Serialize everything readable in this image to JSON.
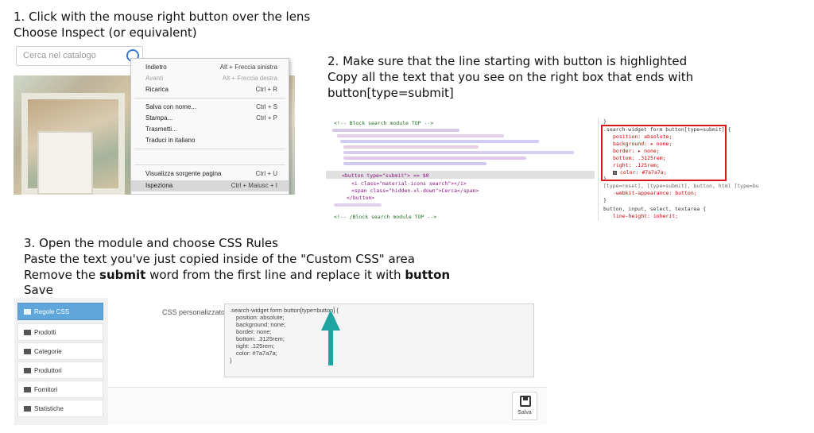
{
  "step1": {
    "line1": "1. Click with the mouse right button over the lens",
    "line2": "Choose Inspect (or equivalent)"
  },
  "step2": {
    "line1": "2. Make sure that the line starting with button is highlighted",
    "line2": "Copy all the text that you see on the right box that ends with",
    "line3": "button[type=submit]"
  },
  "step3": {
    "line1": "3. Open the module and choose CSS Rules",
    "line2": "Paste the text you've just copied inside of the \"Custom CSS\" area",
    "line3_pre": "Remove the ",
    "line3_b1": "submit",
    "line3_mid": " word from the first line and replace it with ",
    "line3_b2": "button",
    "line4": "Save"
  },
  "browser": {
    "search_placeholder": "Cerca nel catalogo",
    "context_menu": [
      {
        "label": "Indietro",
        "shortcut": "Alt + Freccia sinistra",
        "disabled": false
      },
      {
        "label": "Avanti",
        "shortcut": "Alt + Freccia destra",
        "disabled": true
      },
      {
        "label": "Ricarica",
        "shortcut": "Ctrl + R",
        "disabled": false
      },
      {
        "label": "Salva con nome...",
        "shortcut": "Ctrl + S",
        "disabled": false
      },
      {
        "label": "Stampa...",
        "shortcut": "Ctrl + P",
        "disabled": false
      },
      {
        "label": "Trasmetti...",
        "shortcut": "",
        "disabled": false
      },
      {
        "label": "Traduci in italiano",
        "shortcut": "",
        "disabled": false
      },
      {
        "label": "Visualizza sorgente pagina",
        "shortcut": "Ctrl + U",
        "disabled": false
      },
      {
        "label": "Ispeziona",
        "shortcut": "Ctrl + Maiusc + I",
        "disabled": false,
        "highlighted": true
      }
    ]
  },
  "devtools": {
    "comment_open": "<!-- Block search module TOP -->",
    "button_open": "<button type=\"submit\"> == $0",
    "icon_line": "<i class=\"material-icons search\"></i>",
    "span_line": "<span class=\"hidden-xl-down\">Cerca</span>",
    "button_close": "</button>",
    "comment_close": "<!-- /Block search module TOP -->",
    "rule_selector": ".search-widget form button[type=submit] {",
    "rule_props": [
      "position: absolute;",
      "background: ▸ none;",
      "border: ▸ none;",
      "bottom: .3125rem;",
      "right: .125rem;",
      "color: #7a7a7a;"
    ],
    "rule_close": "}",
    "rule2_selector": "[type=reset], [type=submit], button, html [type=button",
    "rule2_prop": "-webkit-appearance: button;",
    "rule3_selector": "button, input, select, textarea {",
    "rule3_prop": "line-height: inherit;"
  },
  "module": {
    "sidebar": [
      {
        "label": "Regole CSS",
        "icon": "css-icon",
        "active": true
      },
      {
        "label": "Prodotti",
        "icon": "list-icon",
        "active": false
      },
      {
        "label": "Categorie",
        "icon": "tag-icon",
        "active": false
      },
      {
        "label": "Produttori",
        "icon": "list-icon",
        "active": false
      },
      {
        "label": "Fornitori",
        "icon": "truck-icon",
        "active": false
      },
      {
        "label": "Statistiche",
        "icon": "stats-icon",
        "active": false
      }
    ],
    "css_label": "CSS personalizzato",
    "css_lines": [
      ".search-widget form button[type=button] {",
      "position: absolute;",
      "background: none;",
      "border: none;",
      "bottom: .3125rem;",
      "right: .125rem;",
      "color: #7a7a7a;",
      "}"
    ],
    "save_label": "Salva",
    "arrow_color": "#1fa5a0"
  }
}
